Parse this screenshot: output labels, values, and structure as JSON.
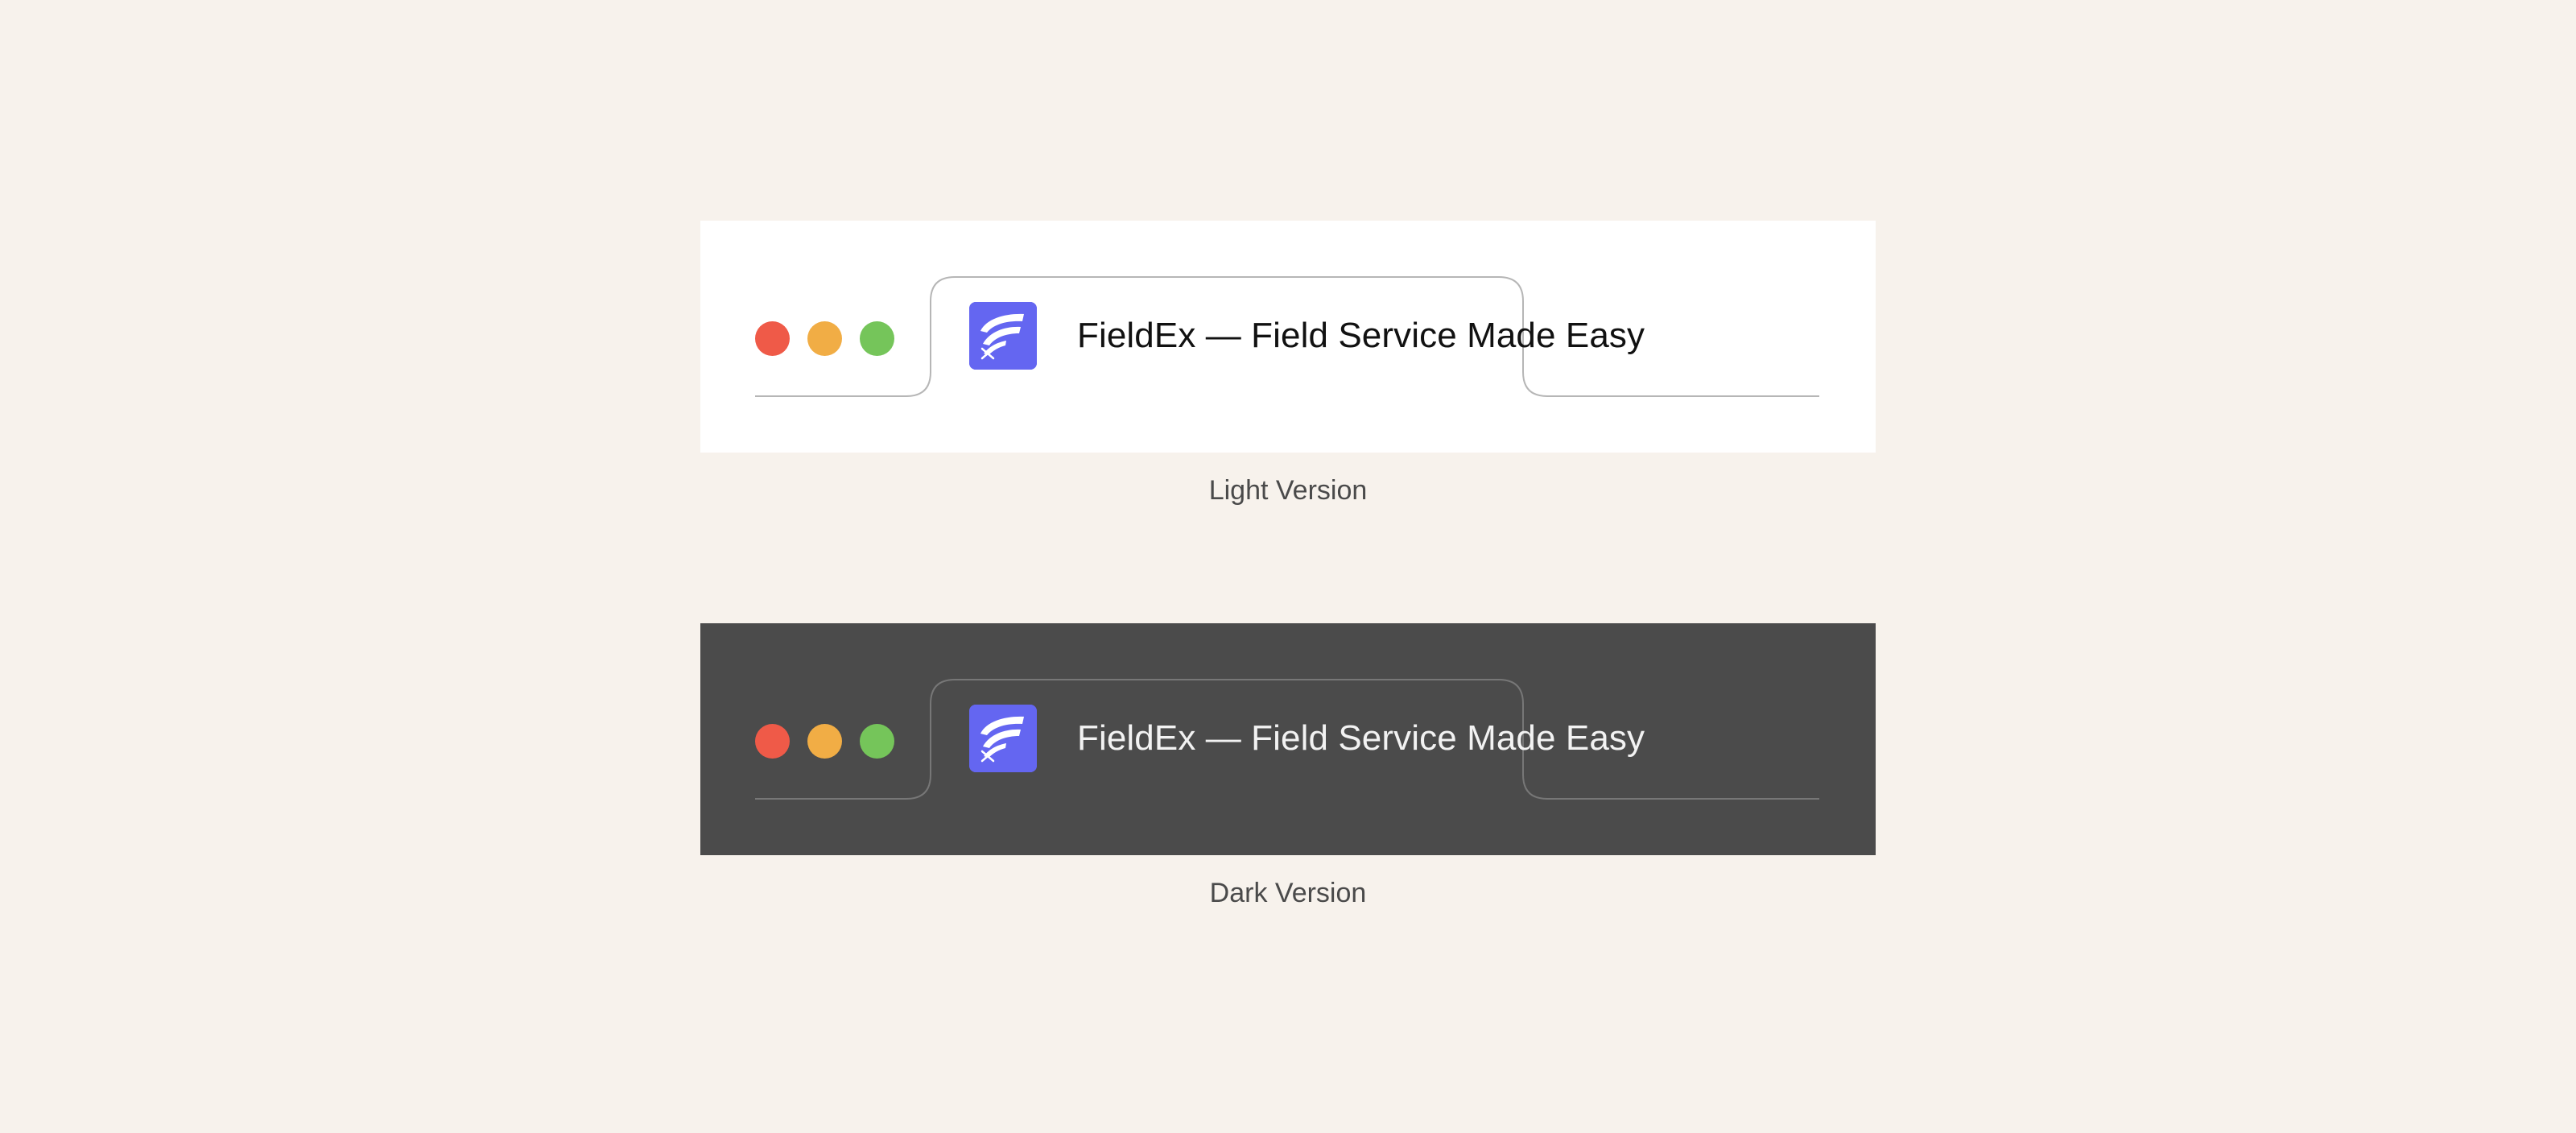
{
  "variants": [
    {
      "theme": "light",
      "caption": "Light Version",
      "window_controls": [
        "close",
        "minimize",
        "maximize"
      ],
      "tab": {
        "title": "FieldEx — Field Service Made Easy",
        "icon": "fieldex-logo-icon",
        "icon_bg": "#6466f1"
      },
      "bar_bg": "#ffffff"
    },
    {
      "theme": "dark",
      "caption": "Dark Version",
      "window_controls": [
        "close",
        "minimize",
        "maximize"
      ],
      "tab": {
        "title": "FieldEx — Field Service Made Easy",
        "icon": "fieldex-logo-icon",
        "icon_bg": "#6466f1"
      },
      "bar_bg": "#4b4b4b"
    }
  ],
  "colors": {
    "page_bg": "#f7f2ec",
    "close": "#ef5a48",
    "minimize": "#f1ad45",
    "maximize": "#75c55a"
  }
}
